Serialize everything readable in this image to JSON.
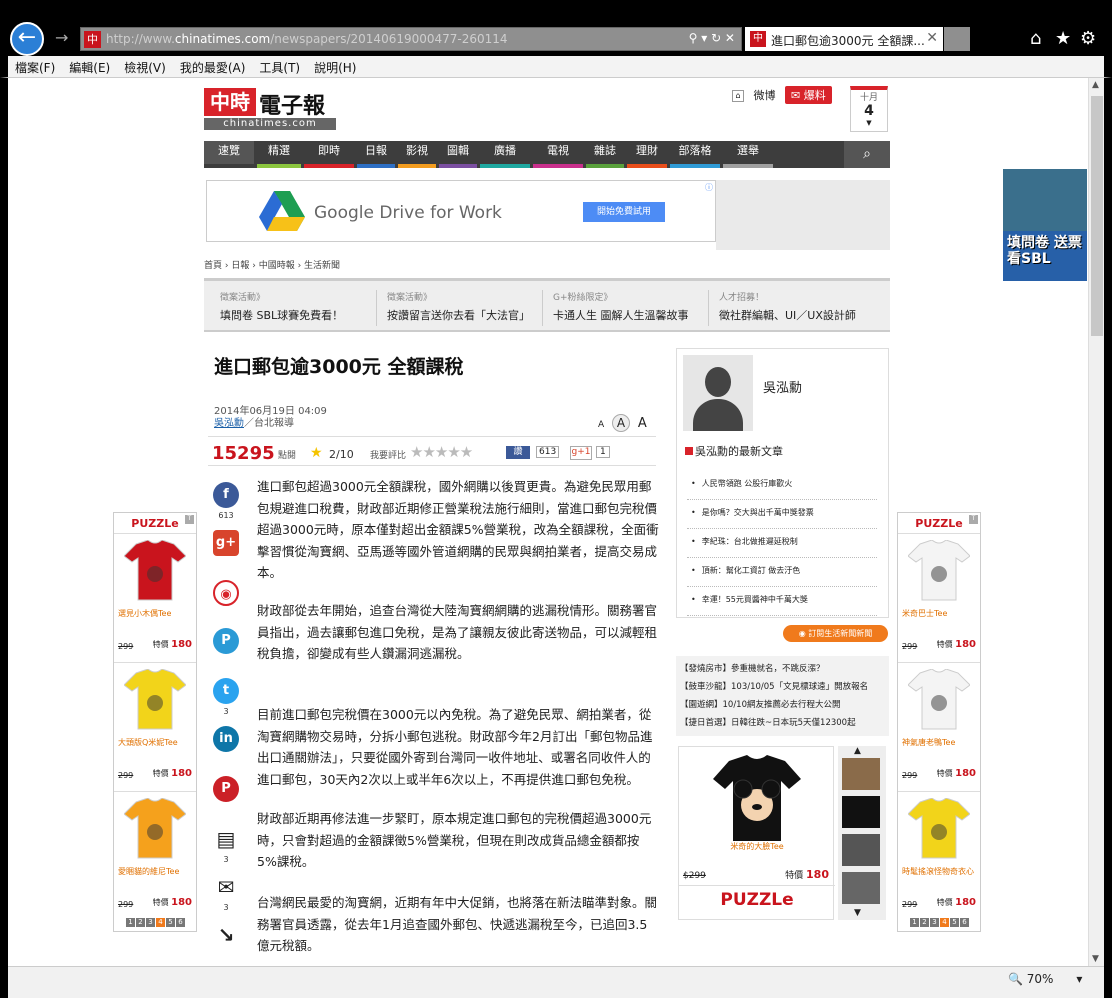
{
  "browser": {
    "url_prefix": "http://www.",
    "url_domain": "chinatimes.com",
    "url_path": "/newspapers/20140619000477-260114",
    "fav": "中",
    "tab_title": "進口郵包逾3000元 全額課...",
    "menu": [
      "檔案(F)",
      "編輯(E)",
      "檢視(V)",
      "我的最愛(A)",
      "工具(T)",
      "說明(H)"
    ],
    "zoom": "70%"
  },
  "site": {
    "logo_red": "中時",
    "logo_text": "電子報",
    "logo_domain": "chinatimes.com",
    "weibo": "微博",
    "baoliao": "爆料",
    "date_month": "十月",
    "date_day": "4"
  },
  "nav": [
    "速覽",
    "精選",
    "即時",
    "日報",
    "影視",
    "圖輯",
    "廣播",
    "電視",
    "雜誌",
    "理財",
    "部落格",
    "選舉"
  ],
  "nav_colors": [
    "#3d3d3d",
    "#8cc63f",
    "#d8232a",
    "#2e6fc4",
    "#f29c1f",
    "#7b4fa1",
    "#1fa8a0",
    "#c9308c",
    "#5aa13c",
    "#e94e1b",
    "#2f9bd6",
    "#a0a0a0"
  ],
  "ad": {
    "google_text": "Google Drive for Work",
    "button": "開始免費試用"
  },
  "breadcrumb": [
    "首頁",
    "日報",
    "中國時報",
    "生活新聞"
  ],
  "promos": [
    {
      "k": "徵案活動》",
      "v": "填問卷 SBL球賽免費看！"
    },
    {
      "k": "徵案活動》",
      "v": "按讚留言送你去看「大法官」"
    },
    {
      "k": "G+粉絲限定》",
      "v": "卡通人生 圖解人生溫馨故事"
    },
    {
      "k": "人才招募！",
      "v": "徵社群編輯、UI／UX設計師"
    }
  ],
  "article": {
    "title": "進口郵包逾3000元 全額課稅",
    "datetime": "2014年06月19日 04:09",
    "author": "吳泓勳",
    "location": "／台北報導",
    "views": "15295",
    "views_label": "點閱",
    "score": "2/10",
    "rate_label": "我要評比",
    "fb_label": "讚",
    "fb_count": "613",
    "gplus_label": "g+1",
    "gplus_count": "1",
    "font_small": "A",
    "font_mid": "A",
    "font_large": "A",
    "paragraphs": [
      "進口郵包超過3000元全額課稅，國外網購以後買更貴。為避免民眾用郵包規避進口稅費，財政部近期修正營業稅法施行細則，當進口郵包完稅價超過3000元時，原本僅對超出金額課5%營業稅，改為全額課稅，全面衝擊習慣從淘寶網、亞馬遜等國外管道網購的民眾與網拍業者，提高交易成本。",
      "財政部從去年開始，追查台灣從大陸淘寶網網購的逃漏稅情形。關務署官員指出，過去讓郵包進口免稅，是為了讓親友彼此寄送物品，可以減輕租稅負擔，卻變成有些人鑽漏洞逃漏稅。",
      "目前進口郵包完稅價在3000元以內免稅。為了避免民眾、網拍業者，從淘寶網購物交易時，分拆小郵包逃稅。財政部今年2月訂出「郵包物品進出口通關辦法」，只要從國外寄到台灣同一收件地址、或署名同收件人的進口郵包，30天內2次以上或半年6次以上，不再提供進口郵包免稅。",
      "財政部近期再修法進一步緊盯，原本規定進口郵包的完稅價超過3000元時，只會對超過的金額課徵5%營業稅，但現在則改成貨品總金額都按5%課稅。",
      "台灣網民最愛的淘寶網，近期有年中大促銷，也將落在新法瞄準對象。關務署官員透露，從去年1月追查國外郵包、快遞逃漏稅至今，已追回3.5億元稅額。"
    ]
  },
  "social_counts": {
    "fb": "613",
    "twitter": "3",
    "comment": "3",
    "mail": "3"
  },
  "author_box": {
    "name": "吳泓勳",
    "latest_title": "吳泓勳的最新文章",
    "latest": [
      "人民幣領跑 公股行庫歡火",
      "是你嗎？交大與出千萬中獎發票",
      "李紀珠：台北做推遲延稅制",
      "頂新：幫化工資訂 做去汙色",
      "幸運！55元買醬神中千萬大獎"
    ],
    "subscribe": "訂閱生活新聞新聞"
  },
  "sponsored": [
    "【發燒房市】參重機就名，不跳反漲？",
    "【鼓車沙龍】103/10/05「文見標球遠」開放報名",
    "【園遊網】10/10網友推薦必去行程大公開",
    "【捷日首選】日韓往跌~日本玩5天僅12300起"
  ],
  "shirt_widget": {
    "name": "米奇的大臉Tee",
    "old_price": "$299",
    "price_label": "特價",
    "price": "180",
    "brand": "PUZZLe"
  },
  "left_ad": {
    "brand": "PUZZLe",
    "items": [
      {
        "name": "選見小木偶Tee",
        "old": "299",
        "label": "特價",
        "price": "180",
        "color": "#c9141d"
      },
      {
        "name": "大頭版Q米妮Tee",
        "old": "299",
        "label": "特價",
        "price": "180",
        "color": "#f2d41a"
      },
      {
        "name": "愛睏貓的維尼Tee",
        "old": "299",
        "label": "特價",
        "price": "180",
        "color": "#f5a11c"
      }
    ],
    "pages": [
      "1",
      "2",
      "3",
      "4",
      "5",
      "6"
    ],
    "active_page": 4
  },
  "right_ad": {
    "brand": "PUZZLe",
    "items": [
      {
        "name": "米奇巴士Tee",
        "old": "299",
        "label": "特價",
        "price": "180",
        "color": "#f4f4f4"
      },
      {
        "name": "神氣唐老鴨Tee",
        "old": "299",
        "label": "特價",
        "price": "180",
        "color": "#f4f4f4"
      },
      {
        "name": "時髦搖滾怪物奇衣心",
        "old": "299",
        "label": "特價",
        "price": "180",
        "color": "#f2d41a"
      }
    ],
    "pages": [
      "1",
      "2",
      "3",
      "4",
      "5",
      "6"
    ],
    "active_page": 4
  },
  "sbl_ad": {
    "text": "填問卷 送票看SBL"
  }
}
